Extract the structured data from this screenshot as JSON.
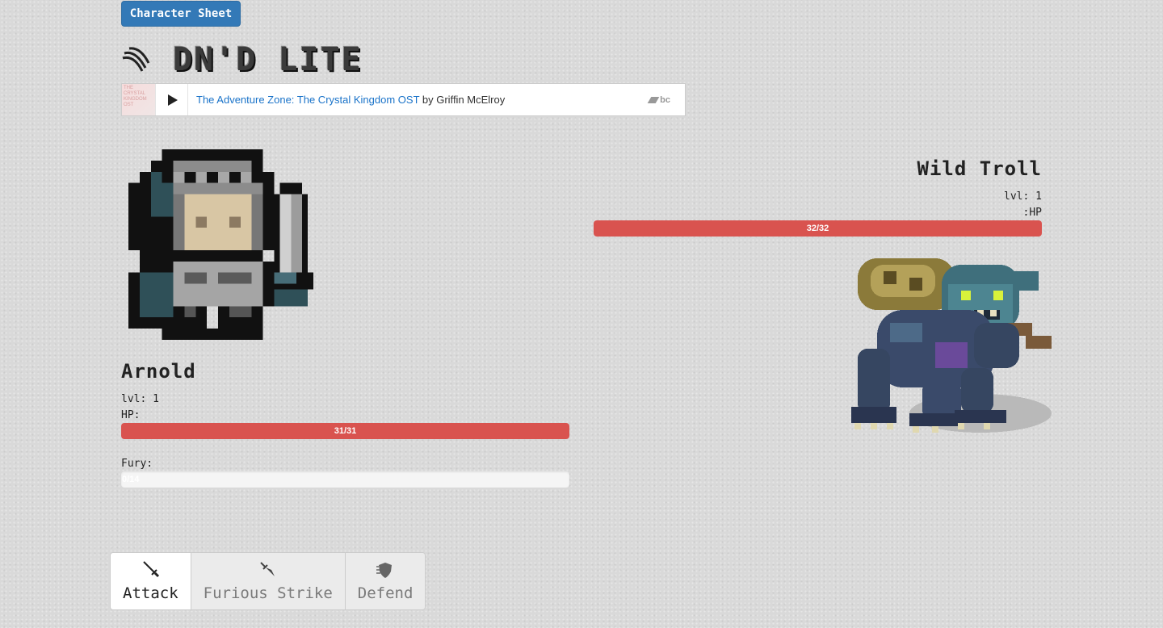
{
  "header": {
    "character_sheet_label": "Character Sheet",
    "logo_text": "DN'D LITE"
  },
  "music_player": {
    "album_art_text": "THE CRYSTAL KINGDOM OST",
    "track_link": "The Adventure Zone: The Crystal Kingdom OST",
    "by_text": " by Griffin McElroy",
    "brand": "bc"
  },
  "player": {
    "name": "Arnold",
    "level": "lvl: 1",
    "hp_label": "HP:",
    "hp_text": "31/31",
    "hp_fraction": 1.0,
    "fury_label": "Fury:",
    "fury_text": "0/14",
    "fury_fraction": 0.0
  },
  "enemy": {
    "name": "Wild Troll",
    "level": "lvl: 1",
    "hp_label": ":HP",
    "hp_text": "32/32",
    "hp_fraction": 1.0
  },
  "actions": [
    {
      "label": "Attack",
      "icon": "sword-icon"
    },
    {
      "label": "Furious Strike",
      "icon": "dagger-strike-icon"
    },
    {
      "label": "Defend",
      "icon": "shield-icon"
    }
  ],
  "colors": {
    "primary_button": "#3379b7",
    "hp_bar": "#d9534f",
    "link": "#1a73c9"
  }
}
